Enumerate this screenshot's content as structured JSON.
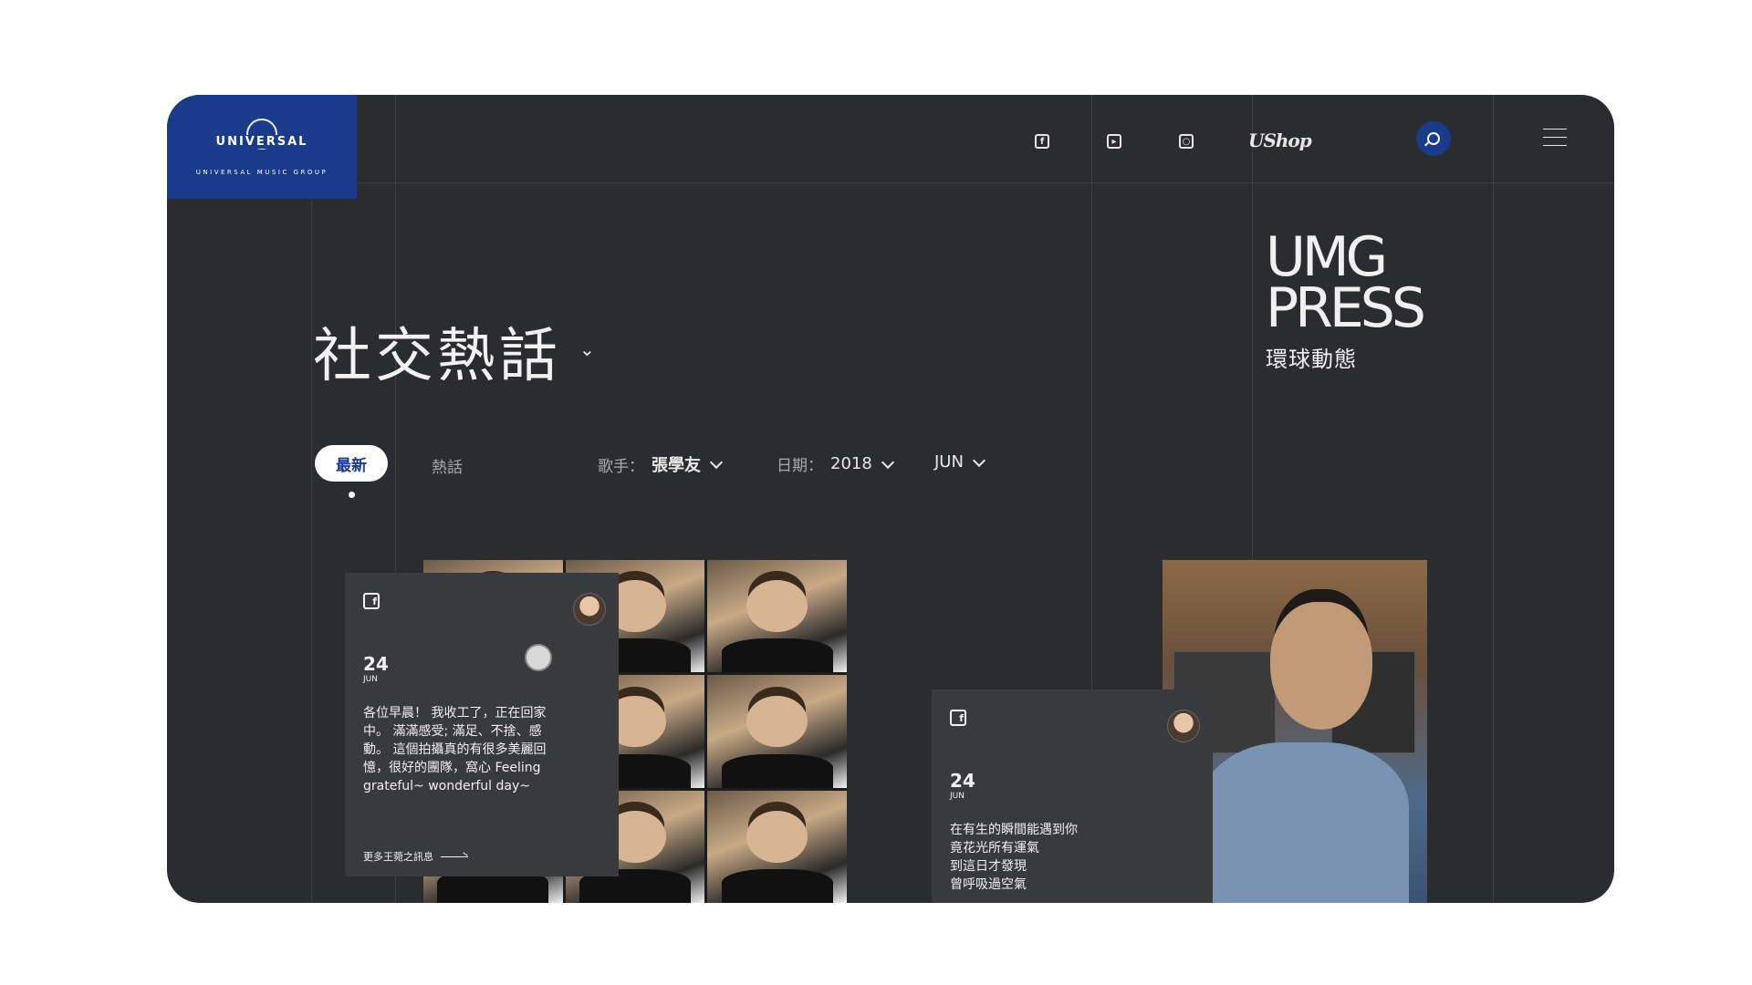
{
  "brand": {
    "name": "UNIVERSAL",
    "subtitle": "UNIVERSAL MUSIC GROUP",
    "color": "#1a3a8a"
  },
  "nav": {
    "icons": [
      "facebook-icon",
      "youtube-icon",
      "instagram-icon"
    ],
    "shop_label": "UShop",
    "search_icon": "search-icon",
    "menu_icon": "hamburger-menu-icon"
  },
  "press": {
    "line1": "UMG",
    "line2": "PRESS",
    "subtitle": "環球動態"
  },
  "page": {
    "title": "社交熱話"
  },
  "tabs": {
    "active": "最新",
    "other": "熱話"
  },
  "filters": {
    "singer_label": "歌手：",
    "singer_value": "張學友",
    "date_label": "日期：",
    "year_value": "2018",
    "month_value": "JUN"
  },
  "posts": [
    {
      "day": "24",
      "month": "JUN",
      "text": "各位早晨！ 我收工了，正在回家\n中。 滿滿感受; 滿足、不捨、感\n動。 這個拍攝真的有很多美麗回\n憶，很好的團隊，窩心 Feeling\ngrateful~ wonderful day~",
      "more": "更多王菀之訊息"
    },
    {
      "day": "24",
      "month": "JUN",
      "text": "在有生的瞬間能遇到你\n竟花光所有運氣\n到這日才發現\n曾呼吸過空氣"
    }
  ]
}
